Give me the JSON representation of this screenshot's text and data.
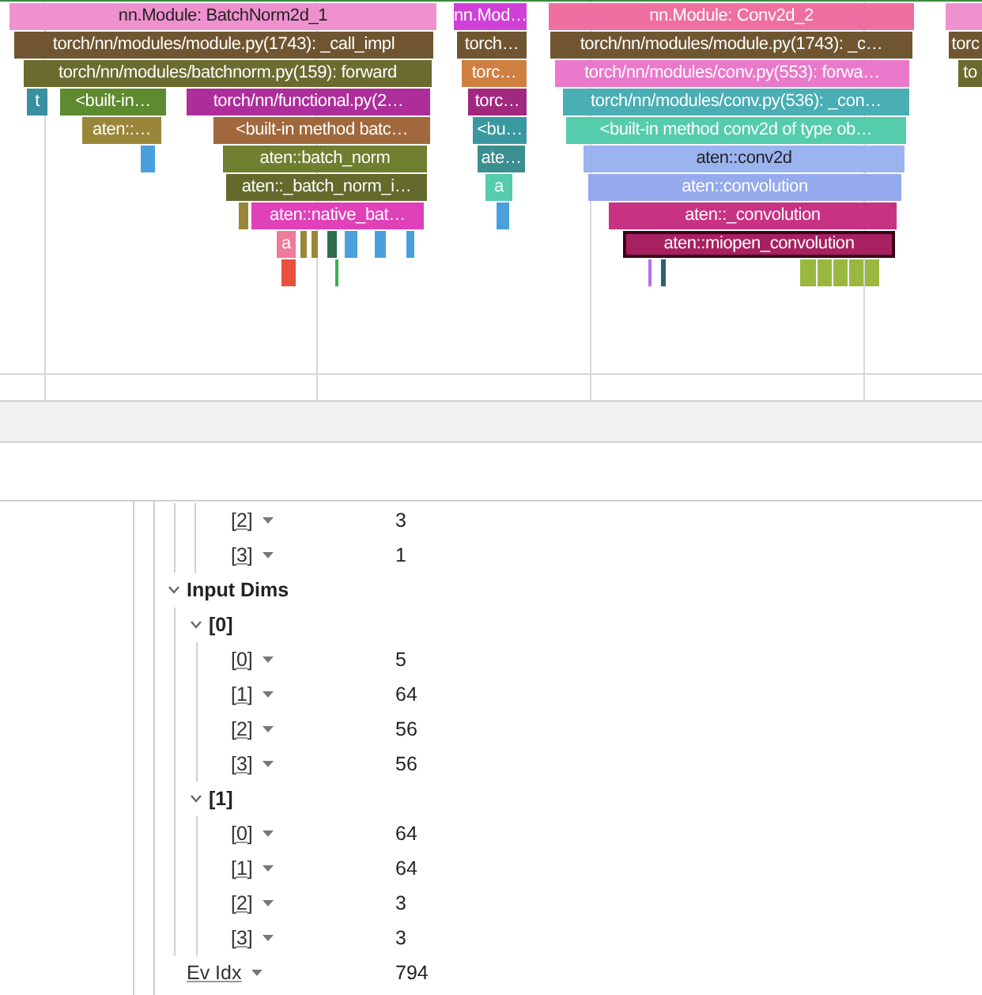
{
  "flame_graph": {
    "slices": [
      {
        "label": "nn.Module: BatchNorm2d_1",
        "color": "#ef91cf",
        "dark_text": true,
        "selected": false
      },
      {
        "label": "nn.Mod…",
        "color": "#d040d8",
        "dark_text": false,
        "selected": false
      },
      {
        "label": "nn.Module: Conv2d_2",
        "color": "#ef6fa0",
        "dark_text": false,
        "selected": false
      },
      {
        "color": "#ef91cf",
        "selected": false
      },
      {
        "label": "torch/nn/modules/module.py(1743): _call_impl",
        "color": "#6f5530",
        "dark_text": false,
        "selected": false
      },
      {
        "label": "torch…",
        "color": "#6f5530",
        "dark_text": false,
        "selected": false
      },
      {
        "label": "torch/nn/modules/module.py(1743): _c…",
        "color": "#6f5530",
        "dark_text": false,
        "selected": false
      },
      {
        "label": "torc",
        "color": "#6f5530",
        "dark_text": false,
        "selected": false
      },
      {
        "label": "torch/nn/modules/batchnorm.py(159): forward",
        "color": "#6b6b30",
        "dark_text": false,
        "selected": false
      },
      {
        "label": "torc…",
        "color": "#cf7f40",
        "dark_text": false,
        "selected": false
      },
      {
        "label": "torch/nn/modules/conv.py(553): forwa…",
        "color": "#ea78cb",
        "dark_text": false,
        "selected": false
      },
      {
        "label": "to",
        "color": "#6b6b30",
        "dark_text": false,
        "selected": false
      },
      {
        "label": "t",
        "color": "#3a8fa0",
        "dark_text": false,
        "selected": false
      },
      {
        "label": "<built-in…",
        "color": "#5e8a30",
        "dark_text": false,
        "selected": false
      },
      {
        "label": "torch/nn/functional.py(2…",
        "color": "#ad2e9a",
        "dark_text": false,
        "selected": false
      },
      {
        "label": "torc…",
        "color": "#a0287e",
        "dark_text": false,
        "selected": false
      },
      {
        "label": "torch/nn/modules/conv.py(536): _con…",
        "color": "#4aaeb4",
        "dark_text": false,
        "selected": false
      },
      {
        "label": "aten::…",
        "color": "#9a8638",
        "dark_text": false,
        "selected": false
      },
      {
        "label": "<built-in method batc…",
        "color": "#a0683c",
        "dark_text": false,
        "selected": false
      },
      {
        "label": "<bu…",
        "color": "#3a98a0",
        "dark_text": false,
        "selected": false
      },
      {
        "label": "<built-in method conv2d of type ob…",
        "color": "#55ccac",
        "dark_text": false,
        "selected": false
      },
      {
        "color": "#4aa0dc",
        "selected": false
      },
      {
        "label": "aten::batch_norm",
        "color": "#6f7f30",
        "dark_text": false,
        "selected": false
      },
      {
        "label": "ate…",
        "color": "#3a8f90",
        "dark_text": false,
        "selected": false
      },
      {
        "label": "aten::conv2d",
        "color": "#9bb4f0",
        "dark_text": true,
        "selected": false
      },
      {
        "label": "aten::_batch_norm_i…",
        "color": "#636a2c",
        "dark_text": false,
        "selected": false
      },
      {
        "label": "a",
        "color": "#55ccac",
        "dark_text": false,
        "selected": false
      },
      {
        "label": "aten::convolution",
        "color": "#94aaec",
        "dark_text": false,
        "selected": false
      },
      {
        "color": "#9a8638",
        "selected": false
      },
      {
        "label": "aten::native_bat…",
        "color": "#e040b8",
        "dark_text": false,
        "selected": false
      },
      {
        "color": "#4aa0dc",
        "selected": false
      },
      {
        "label": "aten::_convolution",
        "color": "#c83282",
        "dark_text": false,
        "selected": false
      },
      {
        "label": "a",
        "color": "#f07a9a",
        "dark_text": false,
        "selected": false
      },
      {
        "color": "#9a8638",
        "selected": false
      },
      {
        "color": "#9a8638",
        "selected": false
      },
      {
        "color": "#2e6e50",
        "selected": false
      },
      {
        "color": "#4aa0dc",
        "selected": false
      },
      {
        "color": "#4aa0dc",
        "selected": false
      },
      {
        "color": "#4aa0dc",
        "selected": false
      },
      {
        "label": "aten::miopen_convolution",
        "color": "#a82060",
        "dark_text": false,
        "selected": true
      },
      {
        "color": "#e85040",
        "selected": false
      },
      {
        "color": "#3ab050",
        "selected": false
      },
      {
        "color": "#b070f0",
        "selected": false
      },
      {
        "color": "#2e6070",
        "selected": false
      },
      {
        "color": "#9ab840",
        "selected": false
      },
      {
        "color": "#9ab840",
        "selected": false
      },
      {
        "color": "#9ab840",
        "selected": false
      },
      {
        "color": "#9ab840",
        "selected": false
      },
      {
        "color": "#9ab840",
        "selected": false
      }
    ]
  },
  "details": {
    "items": [
      {
        "kind": "continued",
        "children": [
          {
            "kind": "leaf",
            "label": "[2]",
            "value": "3"
          },
          {
            "kind": "leaf",
            "label": "[3]",
            "value": "1"
          }
        ]
      },
      {
        "kind": "group",
        "label": "Input Dims",
        "expanded": true,
        "children": [
          {
            "kind": "group",
            "label": "[0]",
            "expanded": true,
            "children": [
              {
                "kind": "leaf",
                "label": "[0]",
                "value": "5"
              },
              {
                "kind": "leaf",
                "label": "[1]",
                "value": "64"
              },
              {
                "kind": "leaf",
                "label": "[2]",
                "value": "56"
              },
              {
                "kind": "leaf",
                "label": "[3]",
                "value": "56"
              }
            ]
          },
          {
            "kind": "group",
            "label": "[1]",
            "expanded": true,
            "children": [
              {
                "kind": "leaf",
                "label": "[0]",
                "value": "64"
              },
              {
                "kind": "leaf",
                "label": "[1]",
                "value": "64"
              },
              {
                "kind": "leaf",
                "label": "[2]",
                "value": "3"
              },
              {
                "kind": "leaf",
                "label": "[3]",
                "value": "3"
              }
            ]
          }
        ]
      },
      {
        "kind": "leaf",
        "label": "Ev Idx",
        "value": "794"
      }
    ]
  }
}
